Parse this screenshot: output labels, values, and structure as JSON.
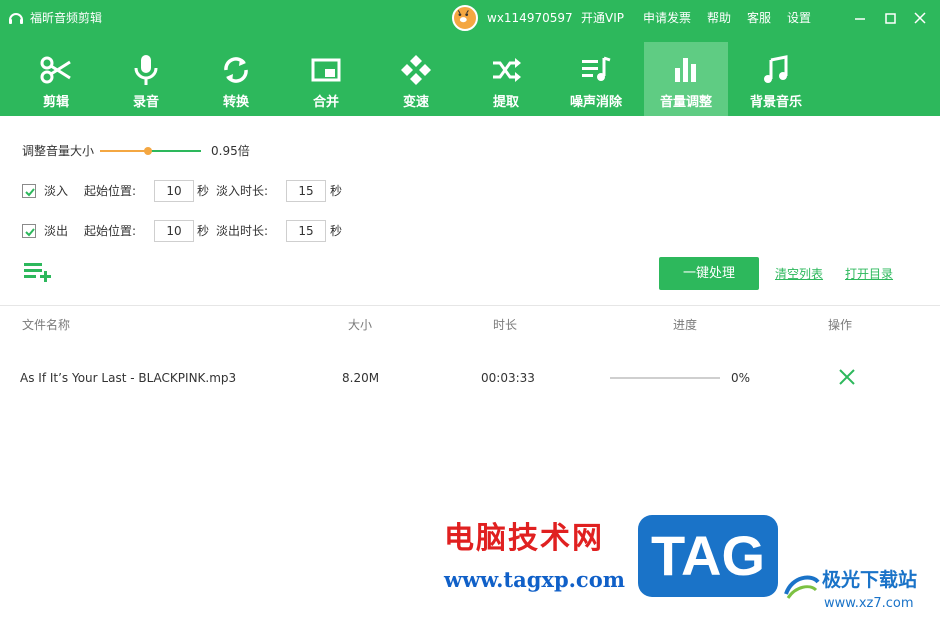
{
  "app": {
    "title": "福昕音频剪辑"
  },
  "user": {
    "name": "wx114970597"
  },
  "top_menu": [
    "开通VIP",
    "申请发票",
    "帮助",
    "客服",
    "设置"
  ],
  "tabs": [
    {
      "label": "剪辑",
      "icon": "scissors-icon"
    },
    {
      "label": "录音",
      "icon": "microphone-icon"
    },
    {
      "label": "转换",
      "icon": "convert-icon"
    },
    {
      "label": "合并",
      "icon": "merge-icon"
    },
    {
      "label": "变速",
      "icon": "speed-icon"
    },
    {
      "label": "提取",
      "icon": "extract-icon"
    },
    {
      "label": "噪声消除",
      "icon": "noise-removal-icon"
    },
    {
      "label": "音量调整",
      "icon": "volume-bars-icon",
      "active": true
    },
    {
      "label": "背景音乐",
      "icon": "music-note-icon"
    }
  ],
  "volume": {
    "label": "调整音量大小",
    "value_text": "0.95倍",
    "slider_fraction": 0.475
  },
  "fade_in": {
    "checkbox_label": "淡入",
    "checked": true,
    "start_label": "起始位置:",
    "start_value": "10",
    "start_unit": "秒",
    "duration_label": "淡入时长:",
    "duration_value": "15",
    "duration_unit": "秒"
  },
  "fade_out": {
    "checkbox_label": "淡出",
    "checked": true,
    "start_label": "起始位置:",
    "start_value": "10",
    "start_unit": "秒",
    "duration_label": "淡出时长:",
    "duration_value": "15",
    "duration_unit": "秒"
  },
  "actions": {
    "process": "一键处理",
    "clear_list": "清空列表",
    "open_dir": "打开目录"
  },
  "table": {
    "headers": {
      "name": "文件名称",
      "size": "大小",
      "duration": "时长",
      "progress": "进度",
      "action": "操作"
    },
    "rows": [
      {
        "name": "As If It’s Your Last - BLACKPINK.mp3",
        "size": "8.20M",
        "duration": "00:03:33",
        "progress_text": "0%",
        "progress_fraction": 0
      }
    ]
  },
  "watermark": {
    "cn": "电脑技术网",
    "url": "www.tagxp.com",
    "tag": "TAG",
    "cn2": "极光下载站",
    "url2": "www.xz7.com"
  },
  "colors": {
    "primary": "#2db85c",
    "active_tab": "#5fcc83",
    "slider_accent": "#f4a742",
    "watermark_red": "#e02020",
    "watermark_blue": "#1a73c8"
  }
}
